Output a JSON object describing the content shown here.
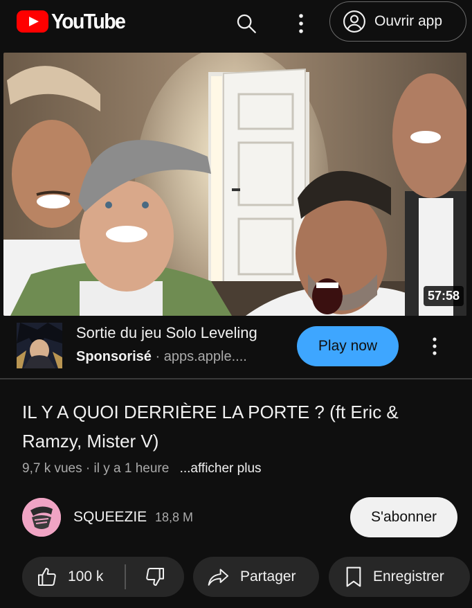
{
  "header": {
    "logo_text": "YouTube",
    "open_app_label": "Ouvrir app"
  },
  "video": {
    "duration": "57:58",
    "title": "IL Y A QUOI DERRIÈRE LA PORTE ? (ft Eric & Ramzy, Mister V)",
    "views": "9,7 k vues",
    "age": "il y a 1 heure",
    "show_more": "...afficher plus"
  },
  "ad": {
    "title": "Sortie du jeu Solo Leveling",
    "sponsored": "Sponsorisé",
    "separator": "·",
    "domain": "apps.apple....",
    "cta": "Play now"
  },
  "channel": {
    "name": "SQUEEZIE",
    "subscribers": "18,8 M",
    "subscribe_label": "S'abonner"
  },
  "actions": {
    "likes": "100 k",
    "share_label": "Partager",
    "save_label": "Enregistrer"
  },
  "icons": {
    "search": "search-icon",
    "more": "more-vertical-icon",
    "account": "account-circle-icon",
    "like": "thumbs-up-icon",
    "dislike": "thumbs-down-icon",
    "share": "share-arrow-icon",
    "save": "bookmark-icon"
  },
  "colors": {
    "background": "#0f0f0f",
    "brand_red": "#ff0000",
    "cta_blue": "#3ea6ff",
    "pill_bg": "#272727",
    "avatar_pink": "#f0a4c4"
  }
}
